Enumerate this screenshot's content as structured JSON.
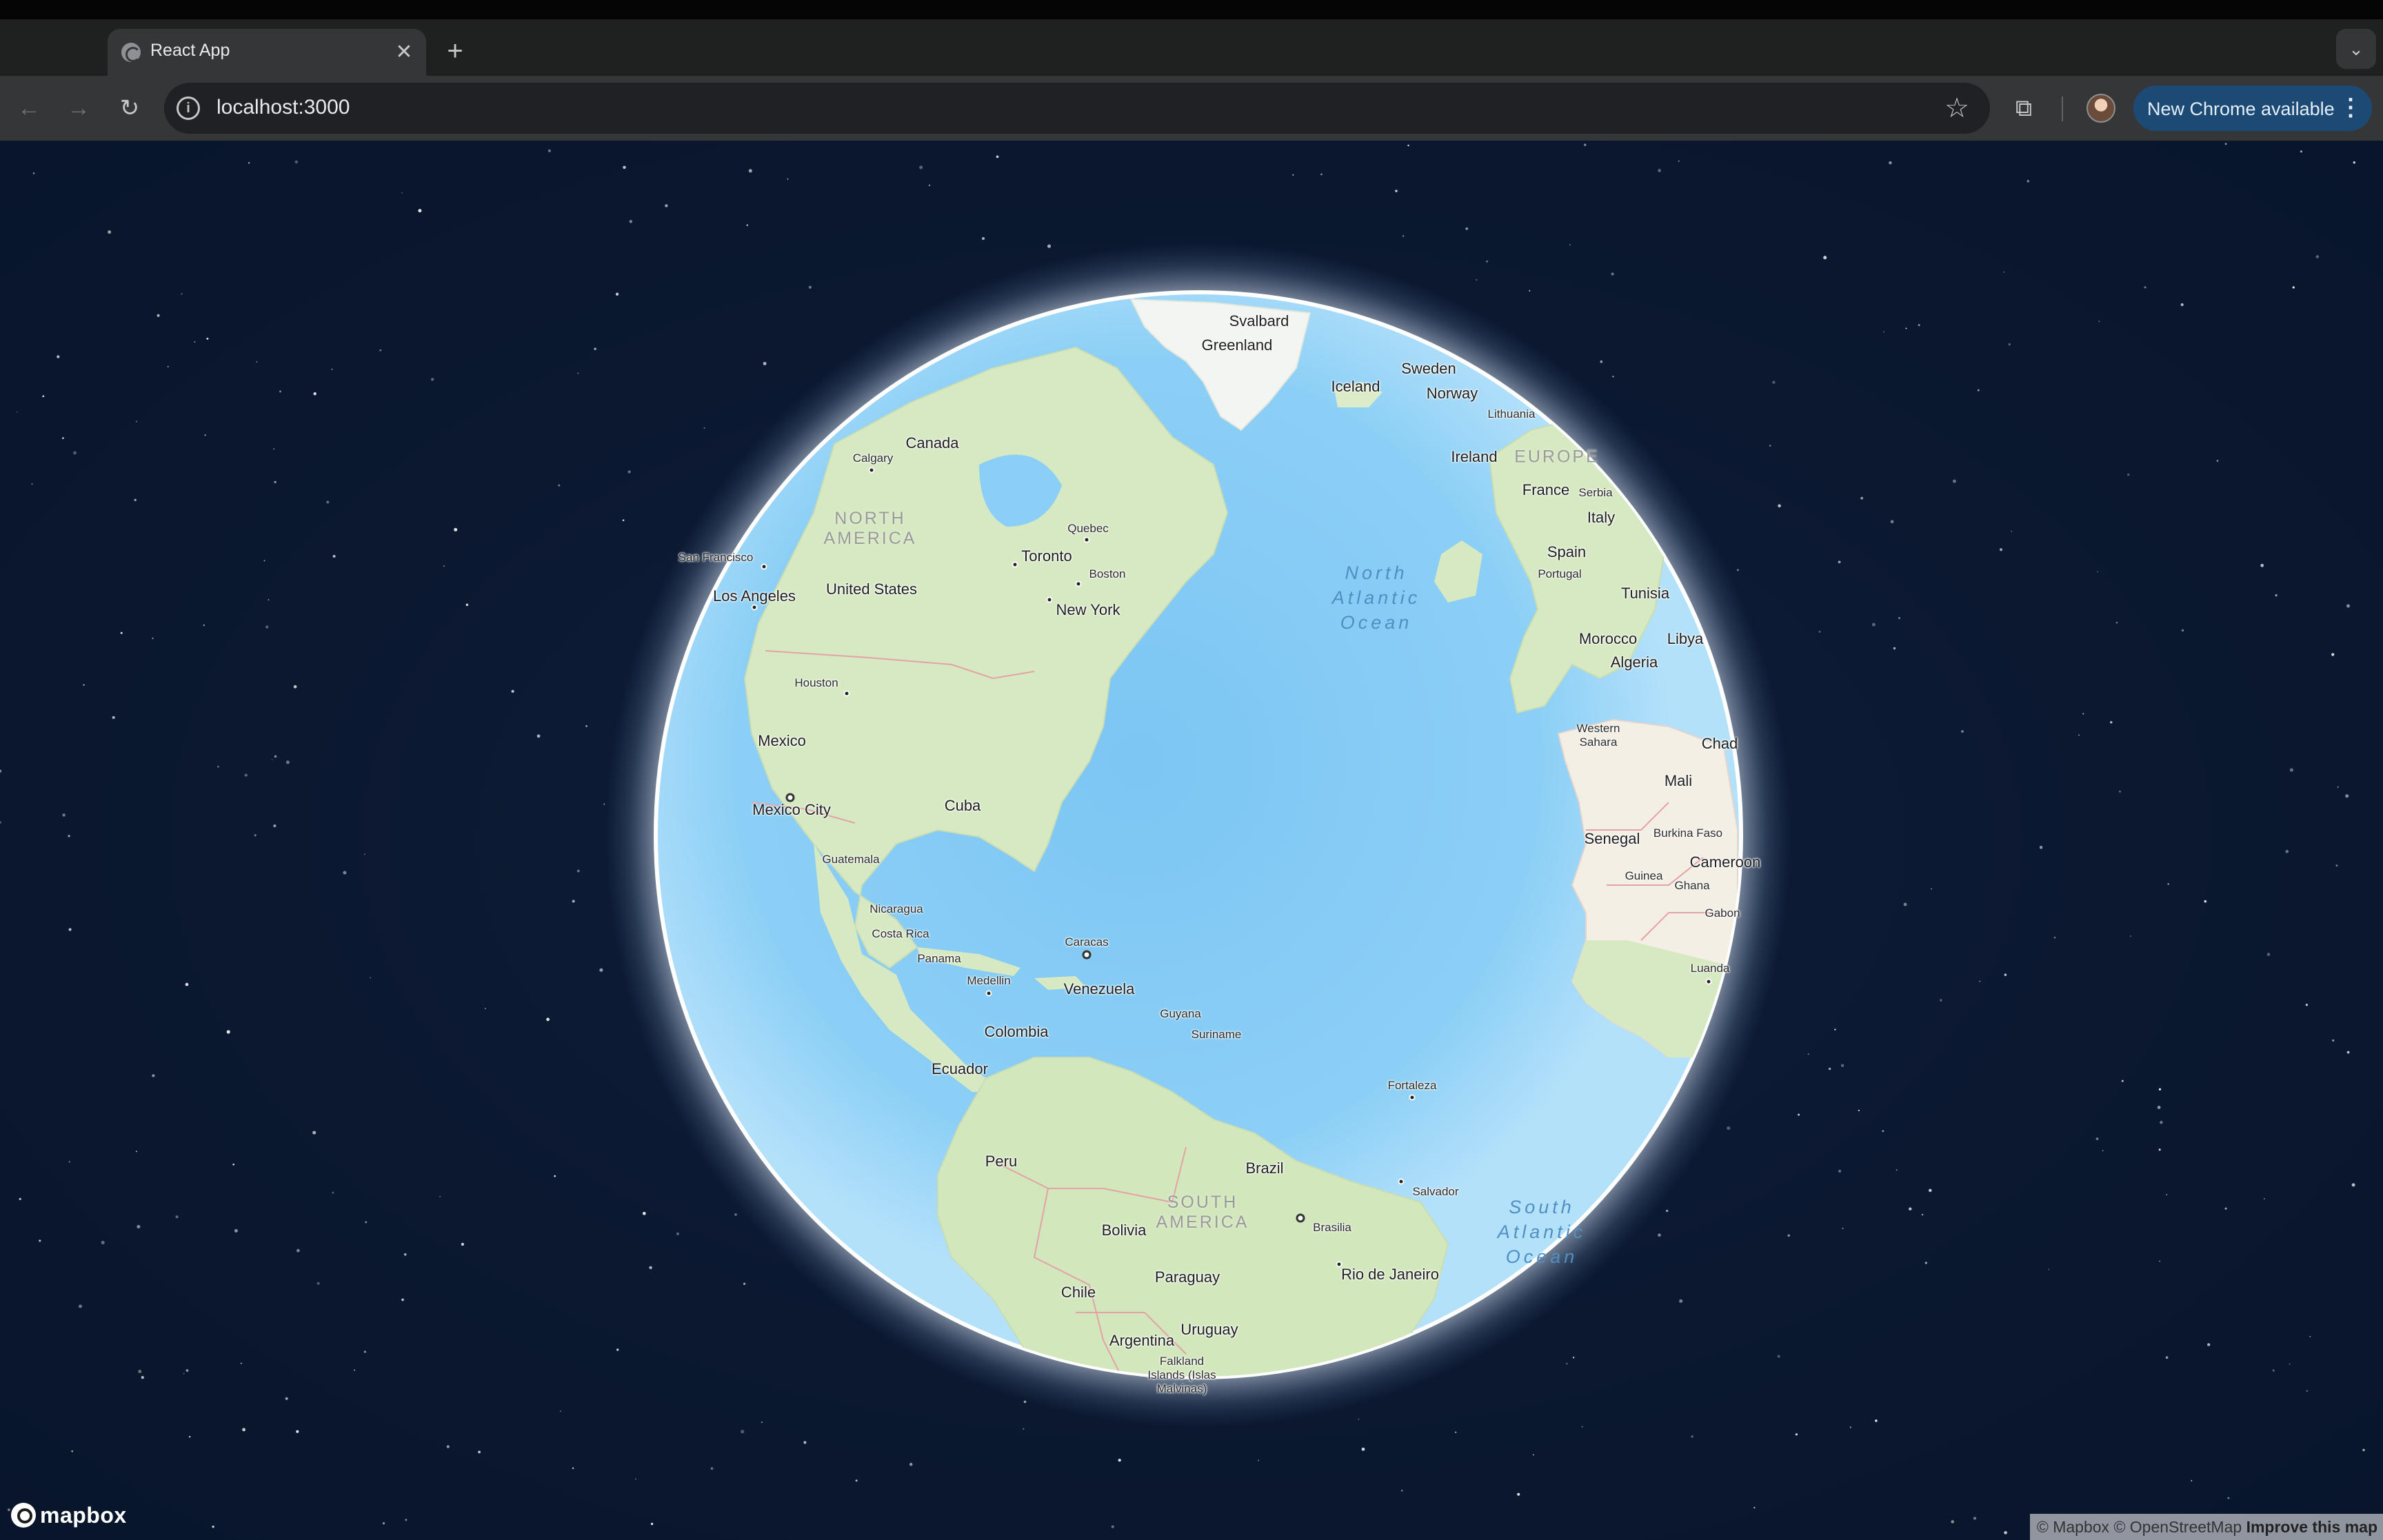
{
  "browser": {
    "tab": {
      "title": "React App",
      "close_glyph": "✕"
    },
    "new_tab_glyph": "+",
    "tab_search_glyph": "⌄",
    "nav": {
      "back_glyph": "←",
      "forward_glyph": "→",
      "reload_glyph": "↻"
    },
    "address_bar": {
      "url": "localhost:3000",
      "info_glyph": "i",
      "bookmark_glyph": "☆"
    },
    "extensions_glyph": "⧉",
    "update_button": {
      "label": "New Chrome available",
      "menu_glyph": "⋮"
    }
  },
  "map": {
    "colors": {
      "space": "#0b1830",
      "ocean": "#8fd0f6",
      "land": "#d9ebc6",
      "ice": "#f4f6f4",
      "atmosphere": "#ffffff"
    },
    "labels": {
      "svalbard": "Svalbard",
      "greenland": "Greenland",
      "iceland": "Iceland",
      "sweden": "Sweden",
      "norway": "Norway",
      "lithuania": "Lithuania",
      "ireland": "Ireland",
      "europe": "EUROPE",
      "france": "France",
      "serbia": "Serbia",
      "italy": "Italy",
      "spain": "Spain",
      "portugal": "Portugal",
      "tunisia": "Tunisia",
      "morocco": "Morocco",
      "libya": "Libya",
      "algeria": "Algeria",
      "western_sahara": "Western\nSahara",
      "chad": "Chad",
      "mali": "Mali",
      "senegal": "Senegal",
      "burkina_faso": "Burkina Faso",
      "guinea": "Guinea",
      "ghana": "Ghana",
      "cameroon": "Cameroon",
      "gabon": "Gabon",
      "luanda": "Luanda",
      "canada": "Canada",
      "calgary": "Calgary",
      "north_america": "NORTH\nAMERICA",
      "quebec": "Quebec",
      "toronto": "Toronto",
      "boston": "Boston",
      "new_york": "New York",
      "san_francisco": "San Francisco",
      "los_angeles": "Los Angeles",
      "united_states": "United States",
      "houston": "Houston",
      "mexico": "Mexico",
      "mexico_city": "Mexico City",
      "cuba": "Cuba",
      "guatemala": "Guatemala",
      "nicaragua": "Nicaragua",
      "costa_rica": "Costa Rica",
      "panama": "Panama",
      "caracas": "Caracas",
      "medellin": "Medellin",
      "venezuela": "Venezuela",
      "guyana": "Guyana",
      "suriname": "Suriname",
      "colombia": "Colombia",
      "ecuador": "Ecuador",
      "fortaleza": "Fortaleza",
      "peru": "Peru",
      "brazil": "Brazil",
      "salvador": "Salvador",
      "south_america": "SOUTH\nAMERICA",
      "brasilia": "Brasilia",
      "bolivia": "Bolivia",
      "paraguay": "Paraguay",
      "rio": "Rio de Janeiro",
      "chile": "Chile",
      "uruguay": "Uruguay",
      "argentina": "Argentina",
      "falkland": "Falkland\nIslands (Islas\nMalvinas)",
      "north_atlantic": "North\nAtlantic\nOcean",
      "south_atlantic": "South\nAtlantic\nOcean"
    },
    "logo_text": "mapbox",
    "attribution": {
      "mapbox": "© Mapbox",
      "osm": "© OpenStreetMap",
      "improve": "Improve this map"
    }
  }
}
